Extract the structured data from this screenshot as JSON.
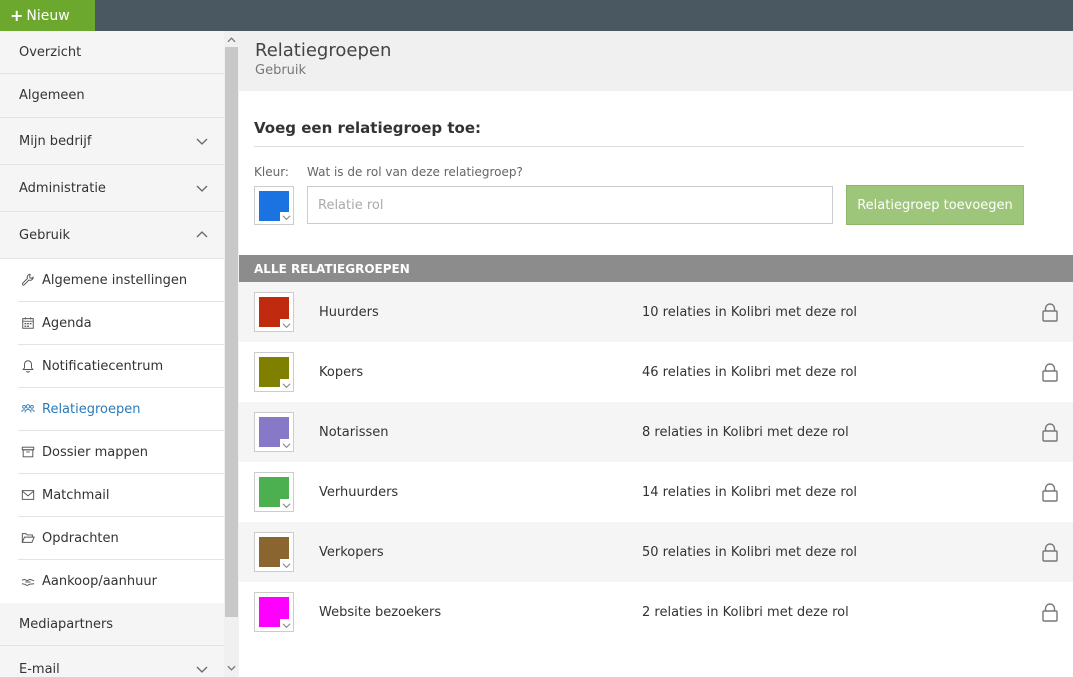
{
  "topbar": {
    "new_label": "Nieuw"
  },
  "sidebar": {
    "items": [
      {
        "label": "Overzicht"
      },
      {
        "label": "Algemeen"
      },
      {
        "label": "Mijn bedrijf"
      },
      {
        "label": "Administratie"
      },
      {
        "label": "Gebruik"
      }
    ],
    "sub_items": [
      {
        "label": "Algemene instellingen",
        "icon": "wrench-icon"
      },
      {
        "label": "Agenda",
        "icon": "calendar-icon"
      },
      {
        "label": "Notificatiecentrum",
        "icon": "bell-icon"
      },
      {
        "label": "Relatiegroepen",
        "icon": "users-icon",
        "active": true
      },
      {
        "label": "Dossier mappen",
        "icon": "archive-icon"
      },
      {
        "label": "Matchmail",
        "icon": "envelope-icon"
      },
      {
        "label": "Opdrachten",
        "icon": "folder-open-icon"
      },
      {
        "label": "Aankoop/aanhuur",
        "icon": "handshake-icon"
      }
    ],
    "bottom_items": [
      {
        "label": "Mediapartners"
      },
      {
        "label": "E-mail"
      }
    ]
  },
  "page": {
    "title": "Relatiegroepen",
    "subtitle": "Gebruik"
  },
  "add_form": {
    "title": "Voeg een relatiegroep toe:",
    "color_label": "Kleur:",
    "role_label": "Wat is de rol van deze relatiegroep?",
    "role_placeholder": "Relatie rol",
    "role_value": "",
    "selected_color": "#1a73e0",
    "submit_label": "Relatiegroep toevoegen"
  },
  "groups": {
    "header": "ALLE RELATIEGROEPEN",
    "rows": [
      {
        "name": "Huurders",
        "count": "10 relaties in Kolibri met deze rol",
        "color": "#c02a0e"
      },
      {
        "name": "Kopers",
        "count": "46 relaties in Kolibri met deze rol",
        "color": "#808000"
      },
      {
        "name": "Notarissen",
        "count": "8 relaties in Kolibri met deze rol",
        "color": "#8878c8"
      },
      {
        "name": "Verhuurders",
        "count": "14 relaties in Kolibri met deze rol",
        "color": "#4caf50"
      },
      {
        "name": "Verkopers",
        "count": "50 relaties in Kolibri met deze rol",
        "color": "#8b6530"
      },
      {
        "name": "Website bezoekers",
        "count": "2 relaties in Kolibri met deze rol",
        "color": "#ff00ff"
      }
    ]
  }
}
